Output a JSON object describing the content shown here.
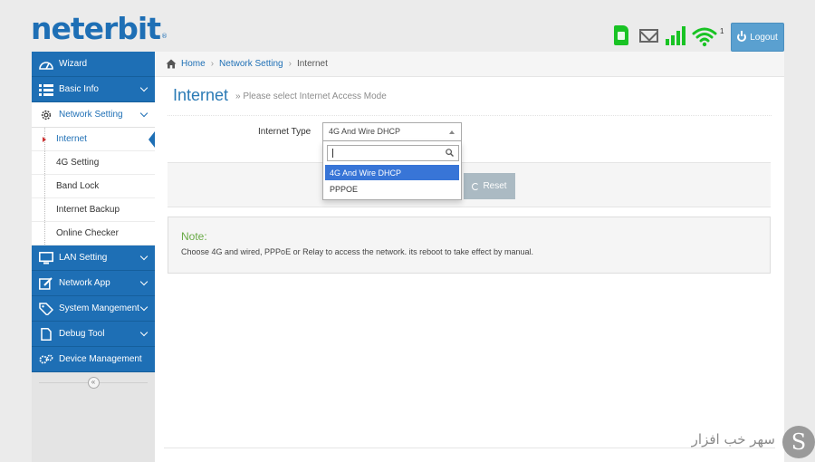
{
  "brand": {
    "logo_text": "neterbit",
    "logo_mark": "®"
  },
  "status": {
    "wifi_clients": "1",
    "sim_color": "#19c324",
    "signal_color": "#19c324"
  },
  "header": {
    "logout_label": "Logout"
  },
  "sidebar": {
    "items": [
      {
        "label": "Wizard",
        "icon": "dashboard-gauge-icon"
      },
      {
        "label": "Basic Info",
        "icon": "list-icon"
      },
      {
        "label": "Network Setting",
        "icon": "gear-icon",
        "open": true,
        "children": [
          {
            "label": "Internet",
            "active": true
          },
          {
            "label": "4G Setting"
          },
          {
            "label": "Band Lock"
          },
          {
            "label": "Internet Backup"
          },
          {
            "label": "Online Checker"
          }
        ]
      },
      {
        "label": "LAN Setting",
        "icon": "monitor-icon"
      },
      {
        "label": "Network App",
        "icon": "edit-icon"
      },
      {
        "label": "System Mangement",
        "icon": "tag-icon"
      },
      {
        "label": "Debug Tool",
        "icon": "file-icon"
      },
      {
        "label": "Device Management",
        "icon": "gears-icon"
      }
    ],
    "collapse_glyph": "«"
  },
  "breadcrumb": {
    "home": "Home",
    "section": "Network Setting",
    "current": "Internet",
    "separator": "›"
  },
  "page": {
    "title": "Internet",
    "subtitle": "» Please select Internet Access Mode"
  },
  "form": {
    "internet_type_label": "Internet Type",
    "internet_type_value": "4G And Wire DHCP",
    "options": [
      "4G And Wire DHCP",
      "PPPOE"
    ],
    "search_value": ""
  },
  "actions": {
    "reset_label": "Reset"
  },
  "note": {
    "title": "Note:",
    "text": "Choose 4G and wired, PPPoE or Relay to access the network. its reboot to take effect by manual."
  },
  "watermark": {
    "text": "سهر خب افزار",
    "mark": "S"
  },
  "colors": {
    "primary": "#1e6fb5",
    "accent": "#3875d7",
    "note": "#69aa46",
    "logout": "#5aa0d0"
  }
}
